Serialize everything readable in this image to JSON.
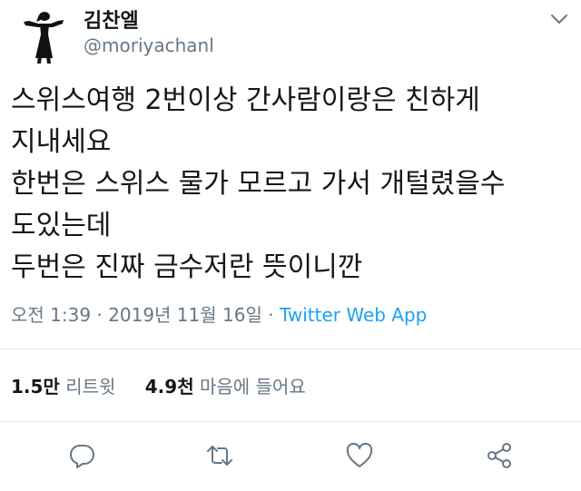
{
  "user": {
    "name": "김찬엘",
    "handle": "@moriyachanl"
  },
  "tweet": {
    "lines": [
      "스위스여행 2번이상 간사람이랑은 친하게",
      "지내세요",
      "한번은 스위스 물가 모르고 가서 개털렸을수",
      "도있는데",
      "두번은 진짜 금수저란 뜻이니깐"
    ]
  },
  "meta": {
    "time": "오전 1:39",
    "separator1": " · ",
    "date": "2019년 11월 16일",
    "separator2": " · ",
    "app": "Twitter Web App"
  },
  "stats": {
    "retweets_count": "1.5만",
    "retweets_label": "리트윗",
    "likes_count": "4.9천",
    "likes_label": "마음에 들어요"
  },
  "icons": {
    "caret": "chevron-down-icon",
    "reply": "reply-icon",
    "retweet": "retweet-icon",
    "like": "heart-icon",
    "share": "share-icon"
  },
  "colors": {
    "text": "#14171a",
    "secondary": "#657786",
    "link": "#1da1f2",
    "divider": "#e1e8ed"
  }
}
